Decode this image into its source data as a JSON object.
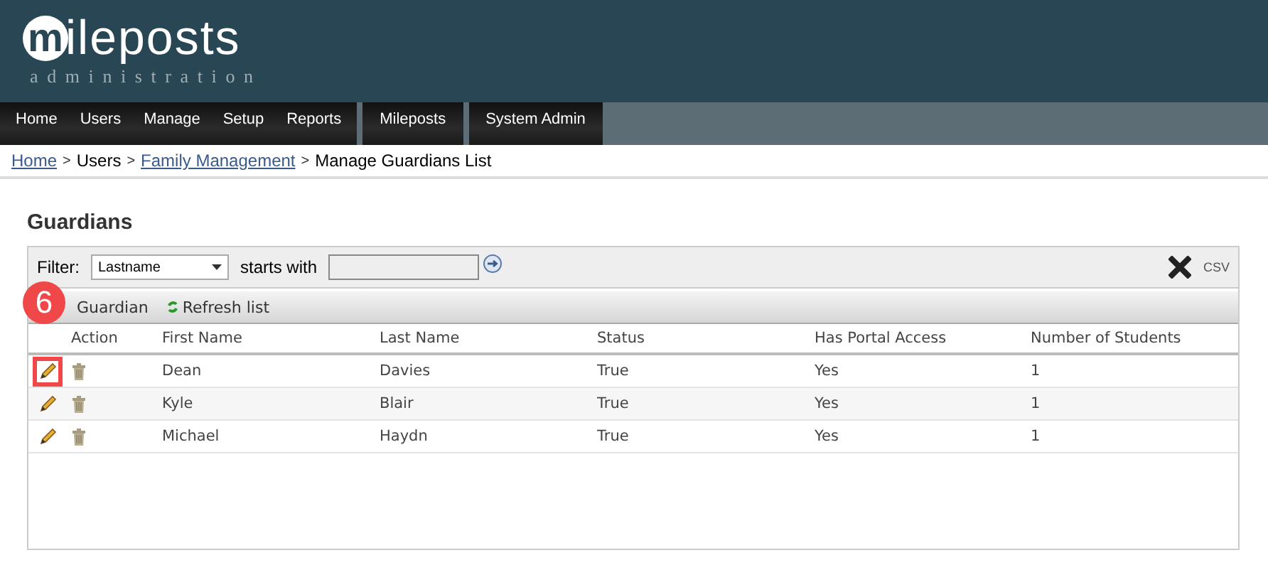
{
  "logo": {
    "initial": "m",
    "rest": "ileposts",
    "subtitle": "administration"
  },
  "nav": [
    {
      "items": [
        "Home",
        "Users",
        "Manage",
        "Setup",
        "Reports"
      ]
    },
    {
      "items": [
        "Mileposts"
      ]
    },
    {
      "items": [
        "System Admin"
      ]
    }
  ],
  "breadcrumb": [
    {
      "kind": "link",
      "label": "Home"
    },
    {
      "kind": "separator",
      "label": ">"
    },
    {
      "kind": "text",
      "label": "Users"
    },
    {
      "kind": "separator",
      "label": ">"
    },
    {
      "kind": "link",
      "label": "Family Management"
    },
    {
      "kind": "separator",
      "label": ">"
    },
    {
      "kind": "text",
      "label": "Manage Guardians List"
    }
  ],
  "page_title": "Guardians",
  "filter": {
    "label": "Filter:",
    "select": "Lastname",
    "starts_with": "starts with",
    "export": "CSV"
  },
  "toolbar": {
    "add": "Guardian",
    "refresh": "Refresh list"
  },
  "annotation": {
    "badge": "6"
  },
  "table": {
    "action_column": "Action",
    "columns": [
      "First Name",
      "Last Name",
      "Status",
      "Has Portal Access",
      "Number of Students"
    ],
    "rows": [
      {
        "highlighted": true,
        "cells": [
          "Dean",
          "Davies",
          "True",
          "Yes",
          "1"
        ]
      },
      {
        "highlighted": false,
        "cells": [
          "Kyle",
          "Blair",
          "True",
          "Yes",
          "1"
        ]
      },
      {
        "highlighted": false,
        "cells": [
          "Michael",
          "Haydn",
          "True",
          "Yes",
          "1"
        ]
      }
    ]
  }
}
